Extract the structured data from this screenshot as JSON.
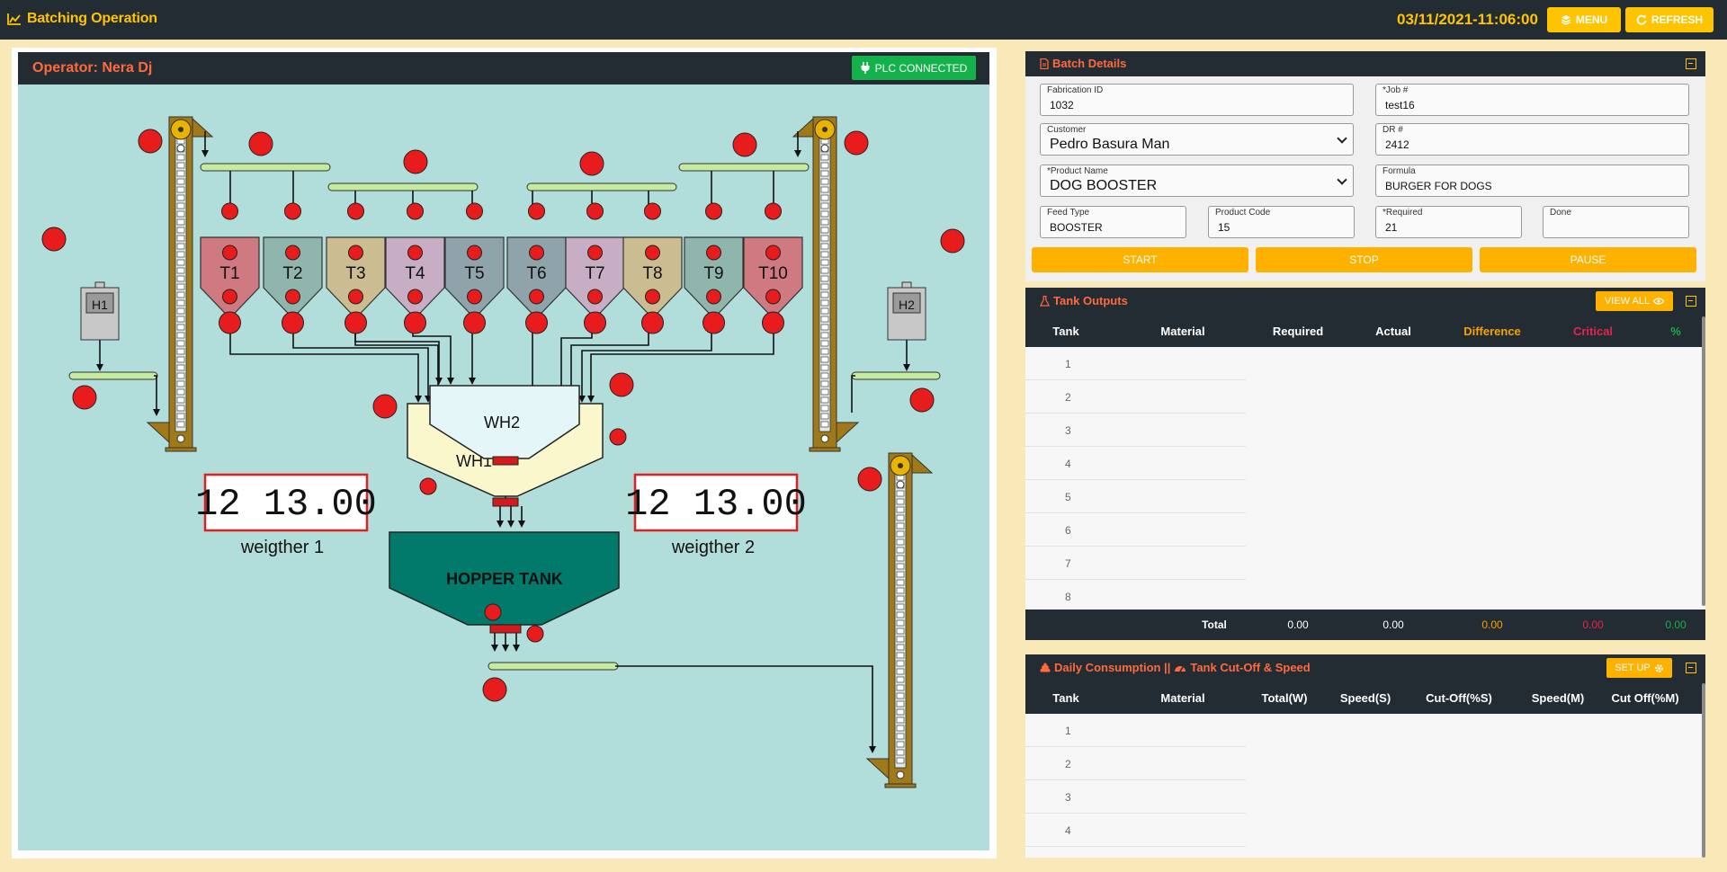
{
  "app": {
    "title": "Batching Operation",
    "datetime": "03/11/2021-11:06:00",
    "menu_label": "MENU",
    "refresh_label": "REFRESH"
  },
  "operator": {
    "label": "Operator: Nera Dj",
    "plc_status": "PLC CONNECTED"
  },
  "plant": {
    "tanks": [
      "T1",
      "T2",
      "T3",
      "T4",
      "T5",
      "T6",
      "T7",
      "T8",
      "T9",
      "T10"
    ],
    "hoppers": [
      "H1",
      "H2"
    ],
    "wh1_label": "WH1",
    "wh2_label": "WH2",
    "hopper_tank_label": "HOPPER TANK",
    "weigher1": {
      "reading": "12 13.00",
      "label": "weigther 1"
    },
    "weigher2": {
      "reading": "12 13.00",
      "label": "weigther 2"
    }
  },
  "batch_details": {
    "title": "Batch Details",
    "fields": {
      "fabrication_id": {
        "label": "Fabrication ID",
        "value": "1032"
      },
      "job": {
        "label": "*Job #",
        "value": "test16"
      },
      "customer": {
        "label": "Customer",
        "value": "Pedro Basura Man"
      },
      "dr": {
        "label": "DR #",
        "value": "2412"
      },
      "product_name": {
        "label": "*Product Name",
        "value": "DOG BOOSTER"
      },
      "formula": {
        "label": "Formula",
        "value": "BURGER FOR DOGS"
      },
      "feed_type": {
        "label": "Feed Type",
        "value": "BOOSTER"
      },
      "product_code": {
        "label": "Product Code",
        "value": "15"
      },
      "required": {
        "label": "*Required",
        "value": "21"
      },
      "done": {
        "label": "Done",
        "value": ""
      }
    },
    "start_label": "START",
    "stop_label": "STOP",
    "pause_label": "PAUSE"
  },
  "tank_outputs": {
    "title": "Tank Outputs",
    "view_all_label": "VIEW ALL",
    "columns": [
      "Tank",
      "Material",
      "Required",
      "Actual",
      "Difference",
      "Critical",
      "%"
    ],
    "rows": [
      "1",
      "2",
      "3",
      "4",
      "5",
      "6",
      "7",
      "8"
    ],
    "total": {
      "label": "Total",
      "required": "0.00",
      "actual": "0.00",
      "difference": "0.00",
      "critical": "0.00",
      "percent": "0.00"
    }
  },
  "daily_consumption": {
    "title_part1": "Daily Consumption ||",
    "title_part2": "Tank Cut-Off & Speed",
    "setup_label": "SET UP",
    "columns": [
      "Tank",
      "Material",
      "Total(W)",
      "Speed(S)",
      "Cut-Off(%S)",
      "Speed(M)",
      "Cut Off(%M)"
    ],
    "rows": [
      "1",
      "2",
      "3",
      "4"
    ]
  },
  "colors": {
    "dark": "#232b33",
    "accent_yellow": "#ffc400",
    "accent_orange": "#ff6a3d",
    "plc_green": "#14b24a",
    "plant_bg": "#b1dedb",
    "indicator_red": "#e81c1c",
    "difference_color": "#f5a300",
    "critical_color": "#e8244a",
    "percent_color": "#18b04a"
  }
}
